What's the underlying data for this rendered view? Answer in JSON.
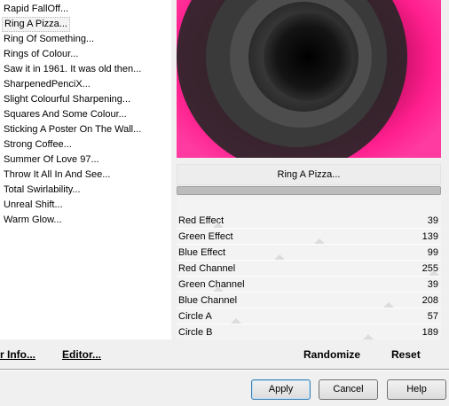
{
  "filters": [
    {
      "label": "Rapid FallOff..."
    },
    {
      "label": "Ring A Pizza...",
      "selected": true
    },
    {
      "label": "Ring Of Something..."
    },
    {
      "label": "Rings of Colour..."
    },
    {
      "label": "Saw it in 1961.  It was old then..."
    },
    {
      "label": "SharpenedPenciX..."
    },
    {
      "label": "Slight Colourful Sharpening..."
    },
    {
      "label": "Squares And Some Colour..."
    },
    {
      "label": "Sticking A Poster On The Wall..."
    },
    {
      "label": "Strong Coffee..."
    },
    {
      "label": "Summer Of Love 97..."
    },
    {
      "label": "Throw It All In And See..."
    },
    {
      "label": "Total Swirlability..."
    },
    {
      "label": "Unreal Shift..."
    },
    {
      "label": "Warm Glow..."
    }
  ],
  "filter_name": "Ring A Pizza...",
  "progress": 1.0,
  "params": [
    {
      "label": "Red Effect",
      "value": "39",
      "level": 0.15
    },
    {
      "label": "Green Effect",
      "value": "139",
      "level": 0.55
    },
    {
      "label": "Blue Effect",
      "value": "99",
      "level": 0.39
    },
    {
      "label": "Red Channel",
      "value": "255",
      "level": 1.0
    },
    {
      "label": "Green Channel",
      "value": "39",
      "level": 0.15
    },
    {
      "label": "Blue Channel",
      "value": "208",
      "level": 0.82
    },
    {
      "label": "Circle A",
      "value": "57",
      "level": 0.22
    },
    {
      "label": "Circle B",
      "value": "189",
      "level": 0.74
    }
  ],
  "links": {
    "info": "r Info...",
    "editor": "Editor..."
  },
  "actions": {
    "randomize": "Randomize",
    "reset": "Reset"
  },
  "buttons": {
    "apply": "Apply",
    "cancel": "Cancel",
    "help": "Help"
  },
  "colors": {
    "preview_pink": "#ff1f8e",
    "preview_dark": "#111111"
  }
}
